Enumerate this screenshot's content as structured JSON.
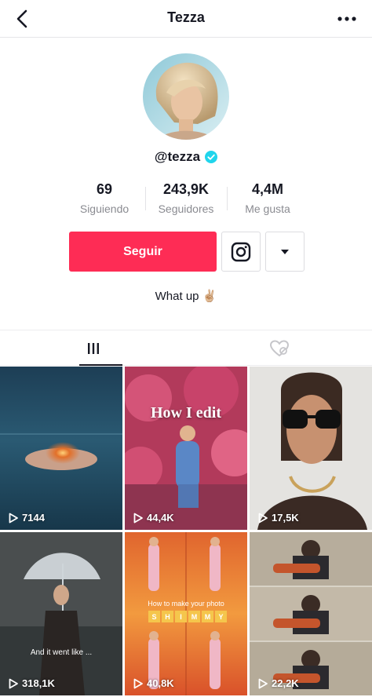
{
  "header": {
    "title": "Tezza",
    "back_icon": "chevron-left-icon",
    "more_icon": "ellipsis-icon"
  },
  "profile": {
    "username": "@tezza",
    "verified": true,
    "verified_color": "#20d5ec",
    "stats": [
      {
        "value": "69",
        "label": "Siguiendo"
      },
      {
        "value": "243,9K",
        "label": "Seguidores"
      },
      {
        "value": "4,4M",
        "label": "Me gusta"
      }
    ],
    "follow_label": "Seguir",
    "follow_color": "#fe2c55",
    "bio": "What up ✌🏼"
  },
  "tabs": [
    {
      "name": "videos",
      "icon": "grid-icon",
      "active": true
    },
    {
      "name": "liked",
      "icon": "liked-hidden-icon",
      "active": false
    }
  ],
  "videos": [
    {
      "views": "7144",
      "overlay": ""
    },
    {
      "views": "44,4K",
      "overlay": "How I edit"
    },
    {
      "views": "17,5K",
      "overlay": ""
    },
    {
      "views": "318,1K",
      "overlay": "And it went like ..."
    },
    {
      "views": "40,8K",
      "overlay": "How to make your photo",
      "overlay_letters": [
        "S",
        "H",
        "I",
        "M",
        "M",
        "Y"
      ]
    },
    {
      "views": "22,2K",
      "overlay": ""
    }
  ]
}
